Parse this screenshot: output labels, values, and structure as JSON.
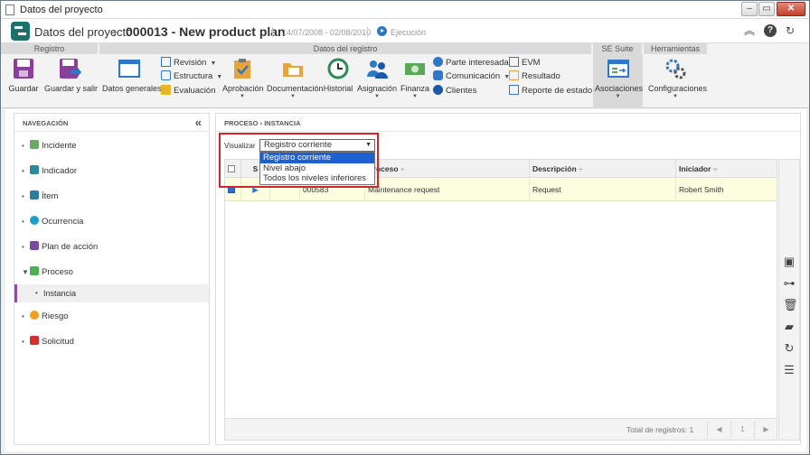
{
  "window": {
    "title": "Datos del proyecto"
  },
  "header": {
    "section": "Datos del proyecto",
    "record": "000013 - New product plan",
    "dates": "14/07/2008 - 02/08/2010",
    "status": "Ejecución"
  },
  "ribbon": {
    "groups": {
      "registro": "Registro",
      "datos": "Datos del registro",
      "se_suite": "SE Suite",
      "herramientas": "Herramientas"
    },
    "guardar": "Guardar",
    "guardar_salir": "Guardar y salir",
    "datos_generales": "Datos generales",
    "revision": "Revisión",
    "estructura": "Estructura",
    "evaluacion": "Evaluación",
    "aprobacion": "Aprobación",
    "documentacion": "Documentación",
    "historial": "Historial",
    "asignacion": "Asignación",
    "finanza": "Finanza",
    "parte_interesada": "Parte interesada",
    "comunicacion": "Comunicación",
    "clientes": "Clientes",
    "evm": "EVM",
    "resultado": "Resultado",
    "reporte_estado": "Reporte de estado",
    "asociaciones": "Asociaciones",
    "configuraciones": "Configuraciones"
  },
  "nav": {
    "title": "NAVEGACIÓN",
    "items": [
      {
        "label": "Incidente",
        "color": "#6aaa64"
      },
      {
        "label": "Indicador",
        "color": "#2a8a9a"
      },
      {
        "label": "Ítem",
        "color": "#2a7f9e"
      },
      {
        "label": "Ocurrencia",
        "color": "#1aa0c8"
      },
      {
        "label": "Plan de acción",
        "color": "#7a4aa0"
      },
      {
        "label": "Proceso",
        "color": "#4caf50"
      },
      {
        "label": "Instancia",
        "color": ""
      },
      {
        "label": "Riesgo",
        "color": "#f0a020"
      },
      {
        "label": "Solicitud",
        "color": "#d03030"
      }
    ]
  },
  "breadcrumb": {
    "part1": "PROCESO",
    "part2": "INSTANCIA"
  },
  "visualizar": {
    "label": "Visualizar",
    "selected": "Registro corriente",
    "options": [
      "Registro corriente",
      "Nivel abajo",
      "Todos los niveles inferiores"
    ]
  },
  "grid": {
    "columns": {
      "s": "S",
      "proceso": "Proceso",
      "descripcion": "Descripción",
      "iniciador": "Iniciador"
    },
    "rows": [
      {
        "id": "000583",
        "proceso": "Maintenance request",
        "descripcion": "Request",
        "iniciador": "Robert Smith"
      }
    ],
    "total": "Total de registros: 1",
    "page": "1"
  },
  "colors": {
    "accent": "#2e77c9",
    "highlight": "#d0262b",
    "selected_row": "#fdfde0"
  }
}
